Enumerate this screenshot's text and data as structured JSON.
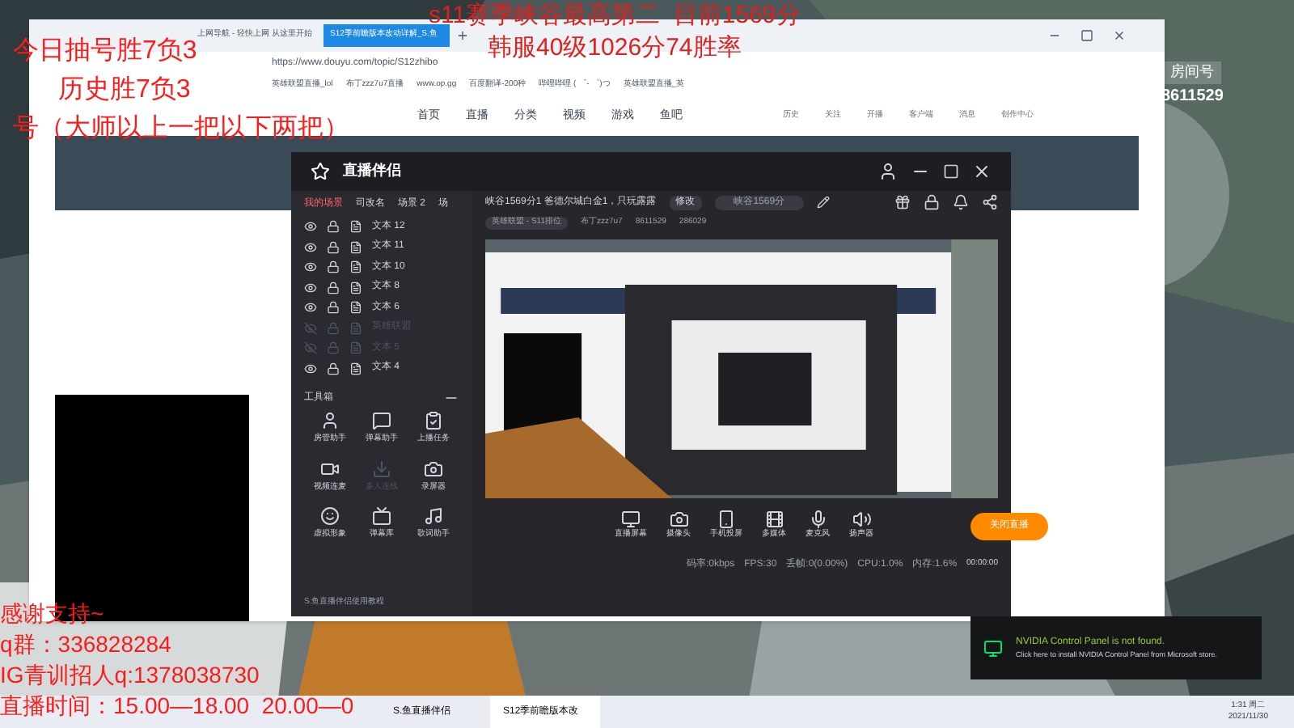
{
  "browser": {
    "tabs": [
      {
        "title": "上网导航 - 轻快上网 从这里开始",
        "selected": false
      },
      {
        "title": "S12季前瞻版本改动详解_S.鱼",
        "selected": true
      }
    ],
    "address": "https://www.douyu.com/topic/S12zhibo",
    "bookmarks": [
      "英雄联盟直播_lol",
      "布丁zzz7u7直播",
      "www.op.gg",
      "百度翻译-200种",
      "哔哩哔哩 ( ゜- ゜)つ",
      "英雄联盟直播_英"
    ],
    "nav": [
      {
        "label": "首页",
        "selected": false
      },
      {
        "label": "直播",
        "selected": false
      },
      {
        "label": "分类",
        "selected": false
      },
      {
        "label": "视频",
        "selected": false
      },
      {
        "label": "游戏",
        "selected": false
      },
      {
        "label": "鱼吧",
        "selected": false
      }
    ],
    "user_links": [
      "历史",
      "关注",
      "开播",
      "客户端",
      "消息",
      "创作中心"
    ]
  },
  "room_badge": {
    "label": "房间号",
    "number": "8611529"
  },
  "studio": {
    "app_name": "直播伴侣",
    "scene_tabs": [
      {
        "label": "我的场景",
        "selected": true
      },
      {
        "label": "司改名",
        "selected": false
      },
      {
        "label": "场景 2",
        "selected": false
      },
      {
        "label": "场",
        "selected": false
      }
    ],
    "sources": [
      {
        "name": "文本 12",
        "visible": true
      },
      {
        "name": "文本 11",
        "visible": true
      },
      {
        "name": "文本 10",
        "visible": true
      },
      {
        "name": "文本 8",
        "visible": true
      },
      {
        "name": "文本 6",
        "visible": true
      },
      {
        "name": "英雄联盟",
        "visible": false
      },
      {
        "name": "文本 5",
        "visible": false
      },
      {
        "name": "文本 4",
        "visible": true
      }
    ],
    "toolbox_title": "工具箱",
    "tools": [
      {
        "label": "房管助手",
        "disabled": false
      },
      {
        "label": "弹幕助手",
        "disabled": false
      },
      {
        "label": "上播任务",
        "disabled": false
      },
      {
        "label": "视频连麦",
        "disabled": false
      },
      {
        "label": "多人连线",
        "disabled": true
      },
      {
        "label": "录屏器",
        "disabled": false
      },
      {
        "label": "虚拟形象",
        "disabled": false
      },
      {
        "label": "弹幕库",
        "disabled": false
      },
      {
        "label": "歌词助手",
        "disabled": false
      }
    ],
    "tutorial": "S.鱼直播伴侣使用教程",
    "stream_title": "峡谷1569分1 爸德尔城白金1，只玩露露",
    "edit_button": "修改",
    "title_field": "峡谷1569分",
    "category": "英雄联盟 - S11排位",
    "streamer": "布丁zzz7u7",
    "room_id": "8611529",
    "viewers": "286029",
    "sources_bar": [
      "直播屏幕",
      "摄像头",
      "手机投屏",
      "多媒体",
      "麦克风",
      "扬声器"
    ],
    "live_button": "关闭直播",
    "stats": [
      "码率:0kbps",
      "FPS:30",
      "丢帧:0(0.00%)",
      "CPU:1.0%",
      "内存:1.6%"
    ],
    "timer": "00:00:00"
  },
  "overlay": {
    "left_top": [
      "今日抽号胜7负3",
      "历史胜7负3",
      "号（大师以上一把以下两把）"
    ],
    "center_top": [
      "s11赛季峡谷最高第二  目前1569分",
      "韩服40级1026分74胜率"
    ],
    "left_bottom": [
      "感谢支持~",
      "q群：336828284",
      "IG青训招人q:1378038730",
      "直播时间：15.00—18.00  20.00—0"
    ]
  },
  "notification": {
    "title": "NVIDIA Control Panel is not found.",
    "body": "Click here to install NVIDIA Control Panel from Microsoft store."
  },
  "taskbar": {
    "apps": [
      {
        "label": "S.鱼直播伴侣",
        "selected": false
      },
      {
        "label": "S12季前瞻版本改",
        "selected": true
      }
    ],
    "time": "1:31 周二",
    "date": "2021/11/30"
  }
}
